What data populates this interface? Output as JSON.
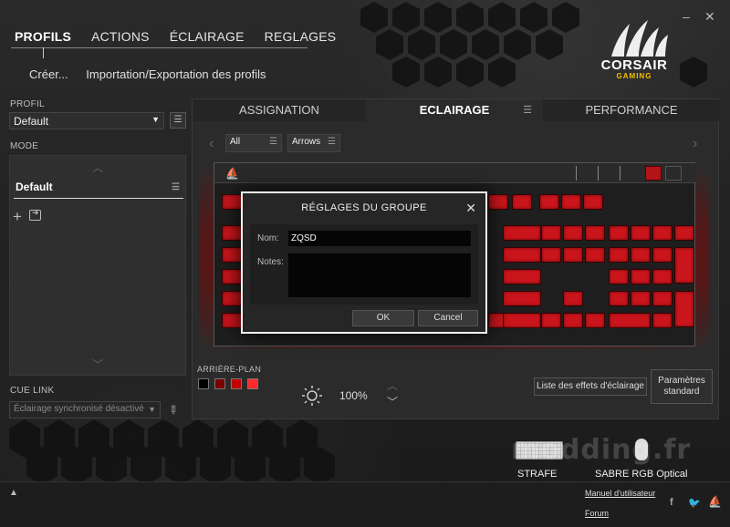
{
  "window": {
    "minimize_icon": "minimize-icon",
    "close_icon": "close-icon"
  },
  "topnav": {
    "items": [
      "PROFILS",
      "ACTIONS",
      "ÉCLAIRAGE",
      "REGLAGES"
    ],
    "active": "PROFILS"
  },
  "subnav": {
    "create": "Créer...",
    "import_export": "Importation/Exportation des profils"
  },
  "logo": {
    "brand": "CORSAIR",
    "sub": "GAMING"
  },
  "sidebar": {
    "profile_label": "PROFIL",
    "profile_value": "Default",
    "mode_label": "MODE",
    "mode_item": "Default",
    "cue_link_label": "CUE LINK",
    "cue_link_value": "Éclairage synchronisé désactivé"
  },
  "tabs": {
    "assign": "ASSIGNATION",
    "lighting": "ECLAIRAGE",
    "performance": "PERFORMANCE",
    "active": "ECLAIRAGE"
  },
  "filters": {
    "all": "All",
    "arrows": "Arrows"
  },
  "dialog": {
    "title": "RÉGLAGES DU GROUPE",
    "name_label": "Nom:",
    "name_value": "ZQSD",
    "notes_label": "Notes:",
    "notes_value": "",
    "ok": "OK",
    "cancel": "Cancel"
  },
  "background": {
    "label": "ARRIÈRE-PLAN",
    "brightness": "100%",
    "swatches": [
      "#000000",
      "#7a0000",
      "#c40000",
      "#ff2a2a"
    ]
  },
  "buttons": {
    "effects_list": "Liste des effets d'éclairage",
    "standard_settings": "Paramètres standard"
  },
  "devices": {
    "keyboard": "STRAFE",
    "mouse": "SABRE RGB Optical"
  },
  "footer": {
    "manual": "Manuel d'utilisateur",
    "forum": "Forum"
  },
  "watermark": "modding.fr",
  "colors": {
    "accent": "#c9151b",
    "background": "#1a1a1a"
  }
}
